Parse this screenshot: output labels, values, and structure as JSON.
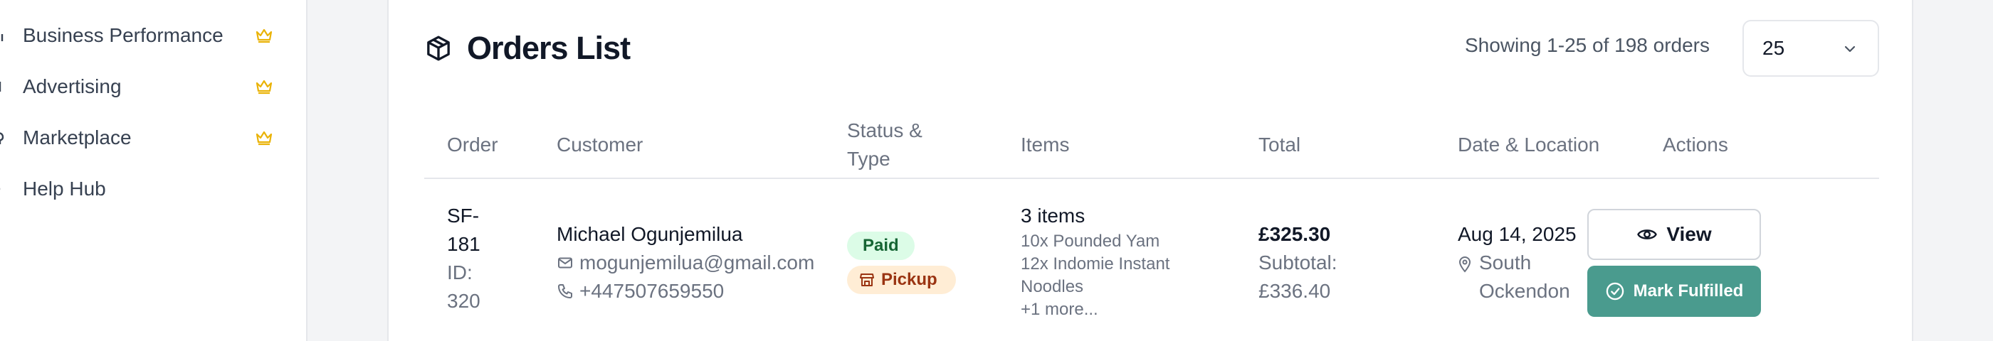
{
  "sidebar": {
    "items": [
      {
        "label": "Business Performance",
        "icon": "chart-icon",
        "premium": true
      },
      {
        "label": "Advertising",
        "icon": "megaphone-icon",
        "premium": true
      },
      {
        "label": "Marketplace",
        "icon": "store-icon",
        "premium": true
      },
      {
        "label": "Help Hub",
        "icon": "help-icon",
        "premium": false
      }
    ],
    "premium_icon": "crown-icon",
    "premium_color": "#eab308"
  },
  "orders": {
    "title": "Orders List",
    "title_icon": "package-icon",
    "showing": "Showing 1-25 of 198 orders",
    "per_page": "25",
    "columns": {
      "order": "Order",
      "customer": "Customer",
      "status_1": "Status &",
      "status_2": "Type",
      "items": "Items",
      "total": "Total",
      "date": "Date & Location",
      "actions": "Actions"
    },
    "rows": [
      {
        "order_1": "SF-",
        "order_2": "181",
        "id_1": "ID:",
        "id_2": "320",
        "customer_name": "Michael Ogunjemilua",
        "email": "mogunjemilua@gmail.com",
        "phone": "+447507659550",
        "payment_status": "Paid",
        "fulfillment_type": "Pickup",
        "items_count": "3 items",
        "item_1": "10x Pounded Yam",
        "item_2": "12x Indomie Instant",
        "item_3": "Noodles",
        "items_more": "+1 more...",
        "total": "£325.30",
        "subtotal_label": "Subtotal:",
        "subtotal": "£336.40",
        "date": "Aug 14, 2025",
        "location_1": "South",
        "location_2": "Ockendon",
        "view_label": "View",
        "fulfill_label": "Mark Fulfilled"
      }
    ]
  },
  "colors": {
    "accent": "#4a9b8e",
    "paid_bg": "#dcfce7",
    "paid_text": "#166534",
    "pickup_bg": "#ffedd5",
    "pickup_text": "#9a3412"
  }
}
